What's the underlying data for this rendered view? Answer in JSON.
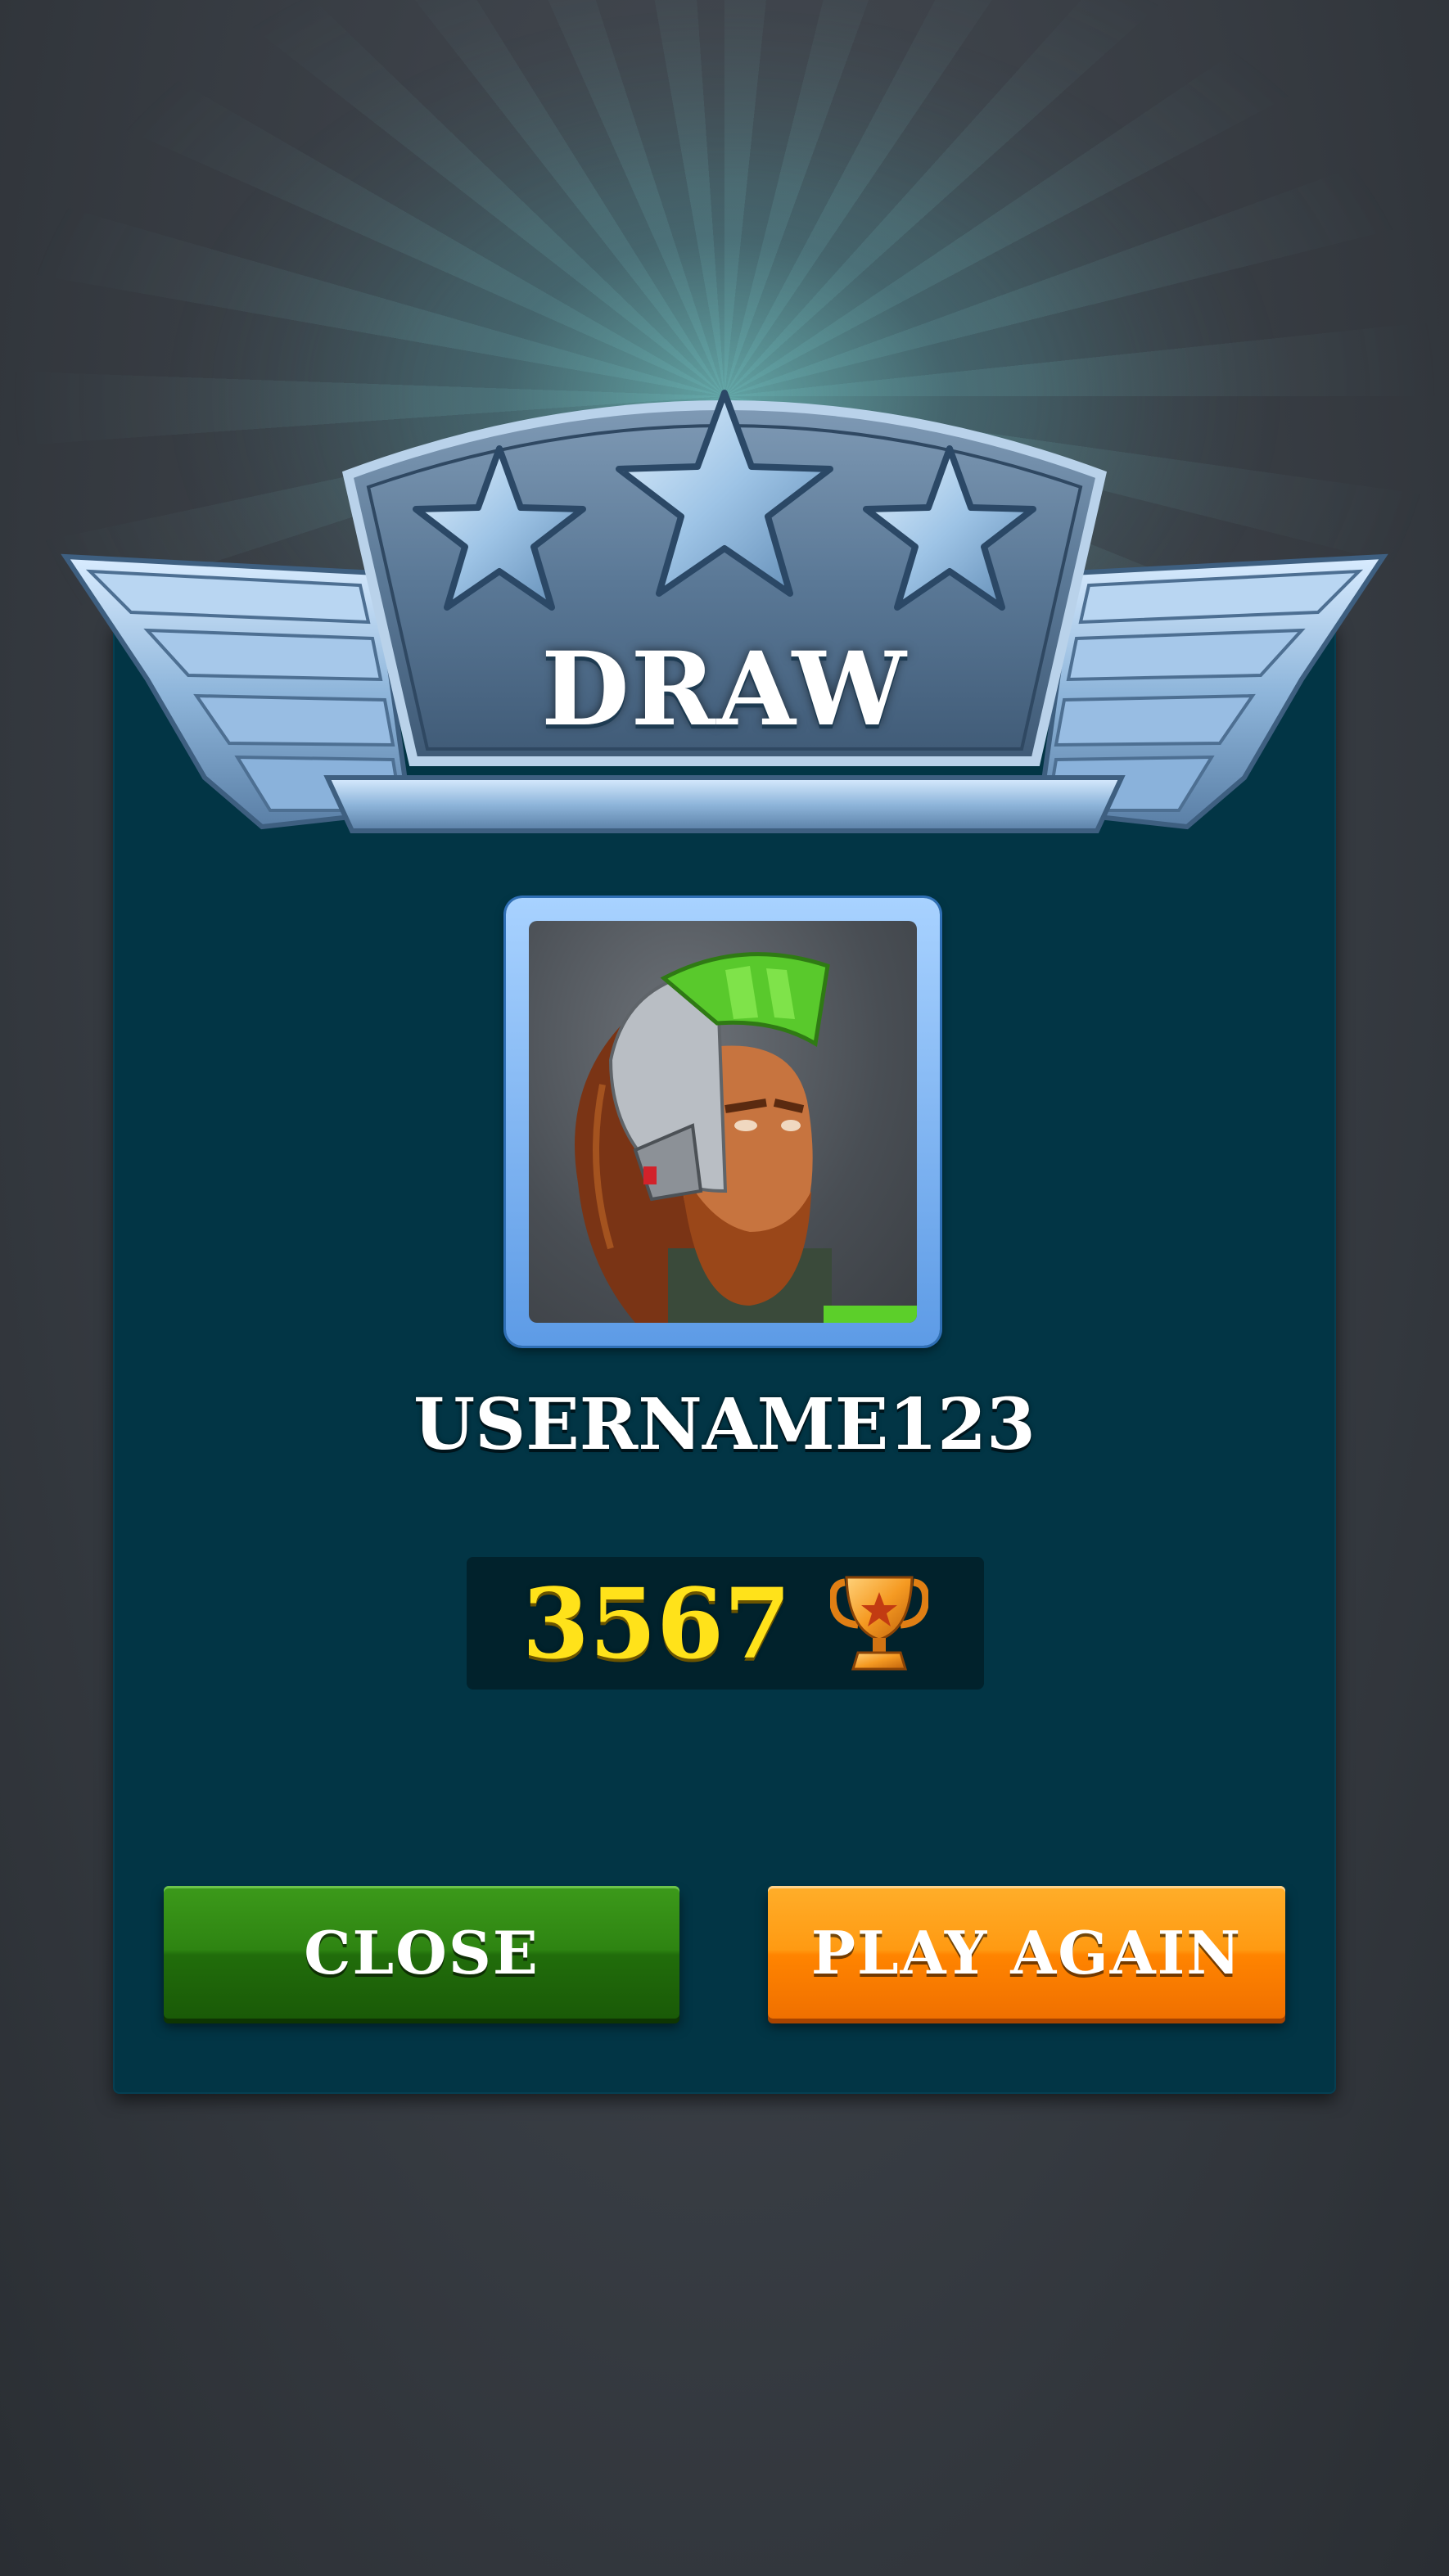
{
  "result": {
    "title": "DRAW",
    "stars_earned": 3,
    "stars_total": 3
  },
  "player": {
    "username": "USERNAME123",
    "avatar_icon": "bearded-pilot-helmet-icon"
  },
  "score": {
    "value": "3567",
    "icon": "trophy-icon"
  },
  "buttons": {
    "close_label": "CLOSE",
    "play_again_label": "PLAY AGAIN"
  },
  "colors": {
    "panel": "#023545",
    "score_text": "#ffe21a",
    "close_button": "#2e8412",
    "play_again_button": "#ff9a12",
    "avatar_frame": "#6aa8f0"
  }
}
